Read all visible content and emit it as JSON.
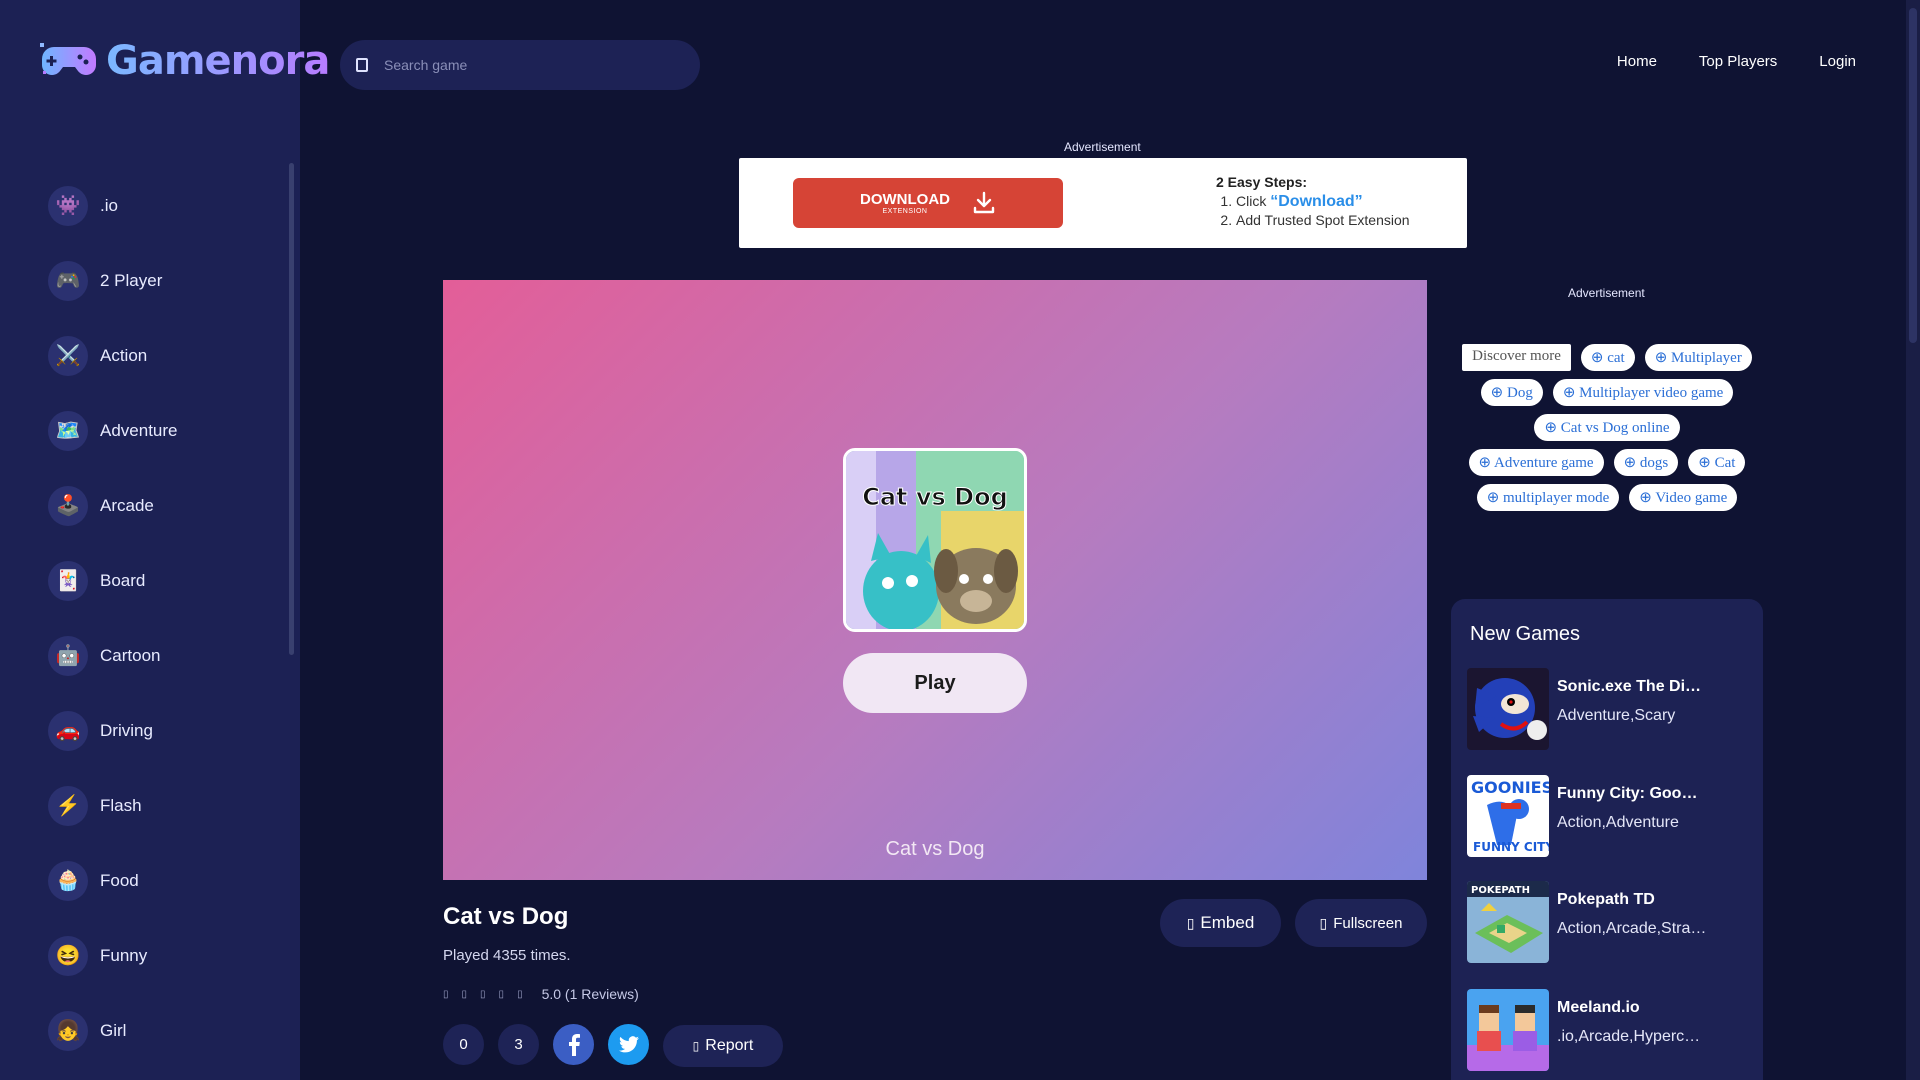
{
  "brand": {
    "name": "Gamenora"
  },
  "search": {
    "placeholder": "Search game"
  },
  "topnav": {
    "home": "Home",
    "top_players": "Top Players",
    "login": "Login"
  },
  "sidebar": {
    "items": [
      {
        "label": ".io",
        "icon": "io-icon",
        "glyph": "👾"
      },
      {
        "label": "2 Player",
        "icon": "two-player-icon",
        "glyph": "🎮"
      },
      {
        "label": "Action",
        "icon": "swords-icon",
        "glyph": "⚔️"
      },
      {
        "label": "Adventure",
        "icon": "map-icon",
        "glyph": "🗺️"
      },
      {
        "label": "Arcade",
        "icon": "arcade-icon",
        "glyph": "🕹️"
      },
      {
        "label": "Board",
        "icon": "cards-icon",
        "glyph": "🃏"
      },
      {
        "label": "Cartoon",
        "icon": "cartoon-icon",
        "glyph": "🤖"
      },
      {
        "label": "Driving",
        "icon": "car-icon",
        "glyph": "🚗"
      },
      {
        "label": "Flash",
        "icon": "flash-icon",
        "glyph": "⚡"
      },
      {
        "label": "Food",
        "icon": "chef-hat-icon",
        "glyph": "🧁"
      },
      {
        "label": "Funny",
        "icon": "laugh-icon",
        "glyph": "😆"
      },
      {
        "label": "Girl",
        "icon": "girl-icon",
        "glyph": "👧"
      }
    ]
  },
  "ads": {
    "top_label": "Advertisement",
    "side_label": "Advertisement",
    "download_label": "DOWNLOAD",
    "download_sub": "EXTENSION",
    "steps_title": "2 Easy Steps:",
    "step1_prefix": "Click ",
    "step1_highlight": "“Download”",
    "step2": "Add Trusted Spot Extension"
  },
  "game": {
    "thumb_title": "Cat vs Dog",
    "play_label": "Play",
    "frame_caption": "Cat vs Dog",
    "title": "Cat vs Dog",
    "played": "Played 4355 times.",
    "rating": "5.0 (1 Reviews)",
    "embed_label": "Embed",
    "fullscreen_label": "Fullscreen",
    "like_count": "0",
    "dislike_count": "3",
    "report_label": "Report"
  },
  "discover": {
    "rows": [
      [
        "Discover more",
        "cat",
        "Multiplayer"
      ],
      [
        "Dog",
        "Multiplayer video game"
      ],
      [
        "Cat vs Dog online"
      ],
      [
        "Adventure game",
        "dogs",
        "Cat"
      ],
      [
        "multiplayer mode",
        "Video game"
      ]
    ]
  },
  "new_games": {
    "title": "New Games",
    "items": [
      {
        "name": "Sonic.exe The Disaster",
        "cats": "Adventure,Scary"
      },
      {
        "name": "Funny City: Goonies",
        "cats": "Action,Adventure"
      },
      {
        "name": "Pokepath TD",
        "cats": "Action,Arcade,Strategy"
      },
      {
        "name": "Meeland.io",
        "cats": ".io,Arcade,Hypercasual"
      }
    ]
  },
  "colors": {
    "bg": "#0f1333",
    "sidebar": "#1c2154",
    "accent_red": "#d64436",
    "link_blue": "#2b6fd6"
  }
}
